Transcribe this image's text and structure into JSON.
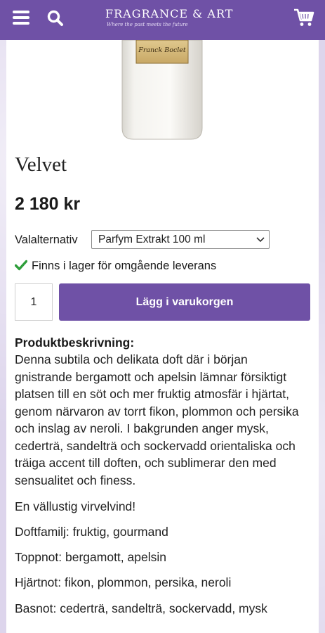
{
  "header": {
    "logo_title": "FRAGRANCE & ART",
    "logo_tagline": "Where the past meets the future",
    "menu_icon": "hamburger-menu-icon",
    "search_icon": "search-icon",
    "cart_icon": "shopping-cart-icon",
    "background_color": "#6f51a6"
  },
  "product": {
    "image_label": "Franck Boclet",
    "title": "Velvet",
    "price": "2 180 kr",
    "option_label": "Valalternativ",
    "option_selected": "Parfym Extrakt 100 ml",
    "stock_text": "Finns i lager för omgående leverans",
    "quantity": "1",
    "add_to_cart_label": "Lägg i varukorgen",
    "accent_color": "#6f51a6",
    "stock_color": "#2e9e3a"
  },
  "description": {
    "heading": "Produktbeskrivning:",
    "lines": [
      "Denna subtila och delikata doft där i början",
      "gnistrande bergamott och apelsin lämnar försiktigt",
      "platsen till en söt och mer fruktig atmosfär i hjärtat,",
      "genom närvaron av torrt fikon, plommon och persika",
      "och inslag av neroli. I bakgrunden anger mysk,",
      "cederträ, sandelträ och sockervadd orientaliska och",
      "träiga accent till doften, och sublimerar den med",
      "sensualitet och finess."
    ],
    "tagline": "En vällustig virvelvind!",
    "family": "Doftfamilj: fruktig, gourmand",
    "top_notes": "Toppnot: bergamott, apelsin",
    "heart_notes": "Hjärtnot: fikon, plommon, persika, neroli",
    "base_notes": "Basnot: cederträ, sandelträ, sockervadd, mysk"
  }
}
